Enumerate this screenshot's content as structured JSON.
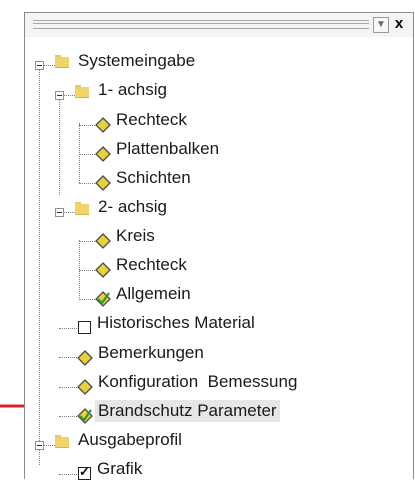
{
  "toolbar": {
    "dropdown_glyph": "▼",
    "close_glyph": "x"
  },
  "tree": {
    "system_input": "Systemeingabe",
    "uniaxial": "1- achsig",
    "uniaxial_items": [
      "Rechteck",
      "Plattenbalken",
      "Schichten"
    ],
    "biaxial": "2- achsig",
    "biaxial_items": [
      "Kreis",
      "Rechteck",
      "Allgemein"
    ],
    "historic_material": "Historisches Material",
    "remarks": "Bemerkungen",
    "design_config": "Konfiguration  Bemessung",
    "fire_protection": "Brandschutz Parameter",
    "output_profile": "Ausgabeprofil",
    "graphics": "Grafik"
  },
  "colors": {
    "diamond_fill": "#e8d23a",
    "diamond_outline": "#4a4a4a",
    "check_green": "#2e9a2e",
    "folder": "#f0d46a",
    "arrow_red": "#e01f26",
    "selection": "#e6e6e6"
  },
  "icons": {
    "expanded": "minus-expander-icon",
    "folder": "folder-icon",
    "node": "diamond-node-icon",
    "node_checked": "diamond-check-node-icon",
    "checkbox": "checkbox-icon"
  }
}
